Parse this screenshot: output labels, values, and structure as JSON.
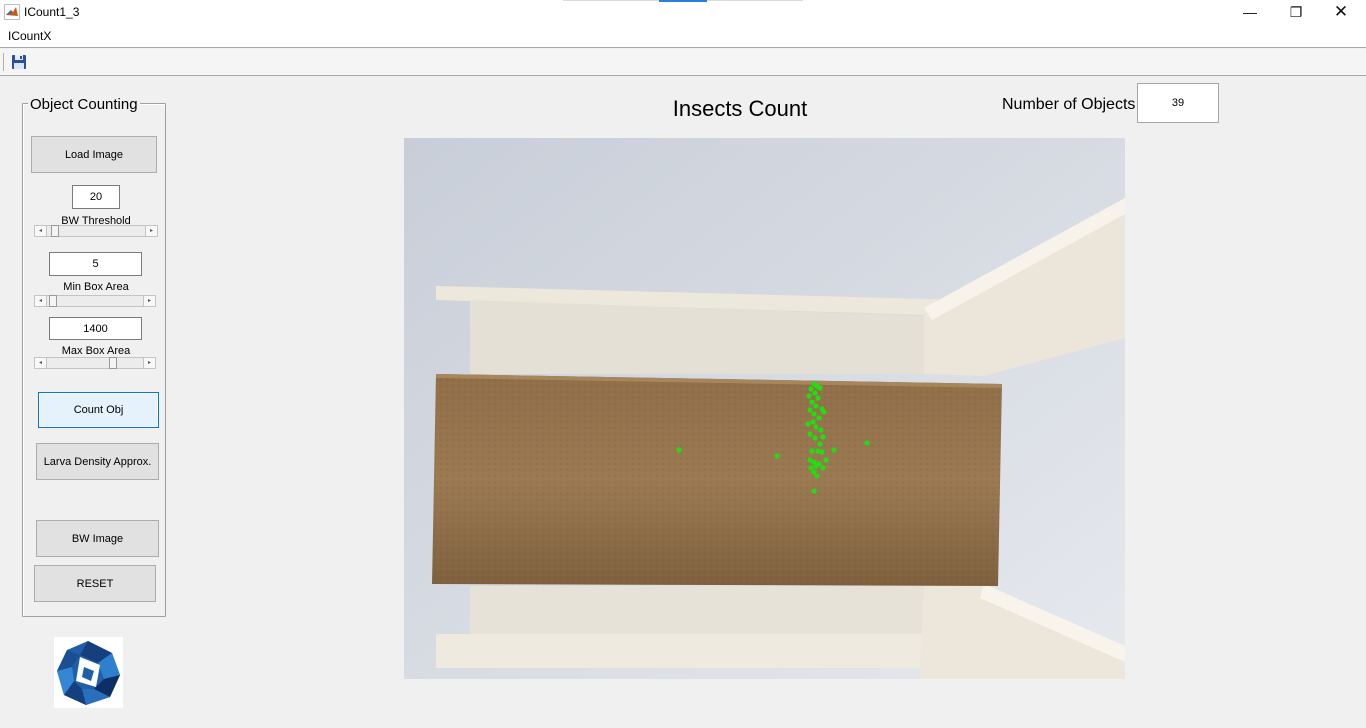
{
  "window": {
    "title": "ICount1_3",
    "minimize_glyph": "—",
    "restore_glyph": "❐",
    "close_glyph": "✕"
  },
  "menu": {
    "items": [
      "ICountX"
    ]
  },
  "toolbar": {
    "save_icon": "floppy-disk-icon"
  },
  "panel": {
    "title": "Object Counting",
    "load_image_label": "Load Image",
    "bw_threshold": {
      "value": "20",
      "label": "BW Threshold",
      "level": 0.1
    },
    "min_box_area": {
      "value": "5",
      "label": "Min Box Area",
      "level": 0.05
    },
    "max_box_area": {
      "value": "1400",
      "label": "Max Box Area",
      "level": 0.6
    },
    "count_obj_label": "Count Obj",
    "larva_density_label": "Larva Density Approx.",
    "bw_image_label": "BW Image",
    "reset_label": "RESET"
  },
  "main": {
    "title": "Insects Count",
    "count_label": "Number of Objects",
    "count_value": "39"
  },
  "colors": {
    "background": "#f0f0f0",
    "button_face": "#e1e1e1",
    "focus_border": "#0078d7",
    "detection_marker": "#22dd11",
    "substrate": "#8a6a45"
  }
}
